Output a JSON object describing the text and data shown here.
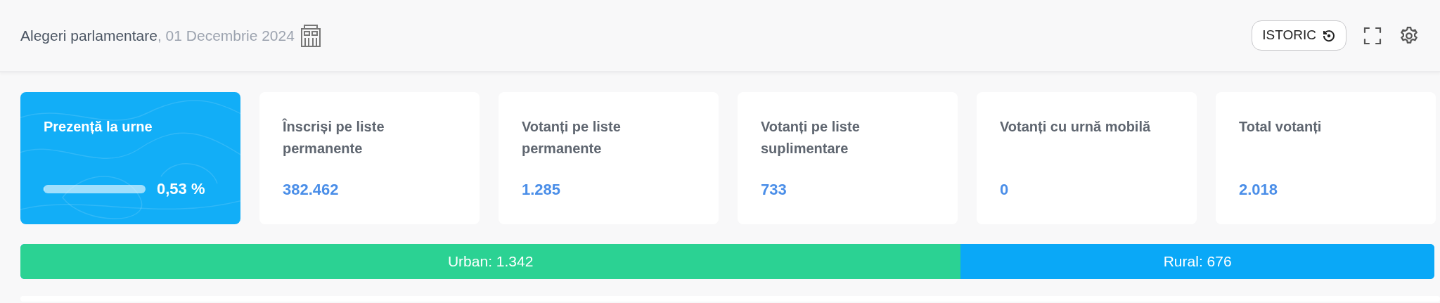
{
  "header": {
    "title": "Alegeri parlamentare",
    "date": ", 01 Decembrie 2024",
    "history_button": "ISTORIC"
  },
  "turnout": {
    "label": "Prezență la urne",
    "level": 0.0053,
    "reading": "0,53 %"
  },
  "stats": [
    {
      "label": "Înscriși pe liste permanente",
      "value": "382.462"
    },
    {
      "label": "Votanți pe liste permanente",
      "value": "1.285"
    },
    {
      "label": "Votanți pe liste suplimentare",
      "value": "733"
    },
    {
      "label": "Votanți cu urnă mobilă",
      "value": "0"
    },
    {
      "label": "Total votanți",
      "value": "2.018"
    }
  ],
  "split": {
    "level": 0.665,
    "segments": [
      {
        "label": "Urban: 1.342",
        "color": "#2bd293"
      },
      {
        "label": "Rural: 676",
        "color": "#0aa8f7"
      }
    ]
  }
}
